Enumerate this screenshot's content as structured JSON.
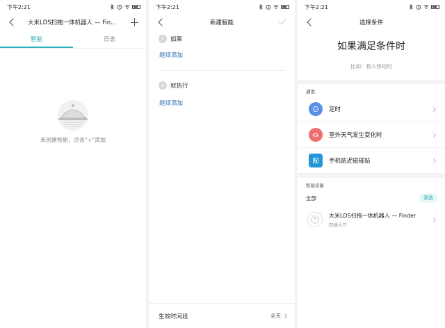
{
  "status": {
    "time": "下午2:21"
  },
  "colors": {
    "accent": "#2ab0b6",
    "link": "#2f6fb4",
    "timer": "#5b8ee6",
    "weather": "#ef6f6f",
    "nfc": "#2196d8"
  },
  "screen1": {
    "title": "大米LDS扫拖一体机器人 — Finder",
    "tabs": [
      {
        "label": "智能"
      },
      {
        "label": "日志"
      }
    ],
    "empty_text": "未创建智能，点击\"+\"添加"
  },
  "screen2": {
    "title": "新建智能",
    "if_step": {
      "number": "1",
      "label": "如果"
    },
    "if_add": "继续添加",
    "then_step": {
      "number": "2",
      "label": "就执行"
    },
    "then_add": "继续添加",
    "footer_label": "生效时间段",
    "footer_value": "全天"
  },
  "screen3": {
    "title": "选择条件",
    "heading": "如果满足条件时",
    "hint": "比如：有人移动时",
    "general_label": "通用",
    "general_items": [
      {
        "label": "定时",
        "icon": "clock-icon"
      },
      {
        "label": "室外天气发生变化时",
        "icon": "weather-icon"
      },
      {
        "label": "手机贴近碰碰贴",
        "icon": "nfc-icon"
      }
    ],
    "devices_label": "智能设备",
    "filter_all": "全部",
    "filter_button": "筛选",
    "device": {
      "name": "大米LDS扫拖一体机器人 — Finder",
      "room": "四楼大厅"
    }
  }
}
